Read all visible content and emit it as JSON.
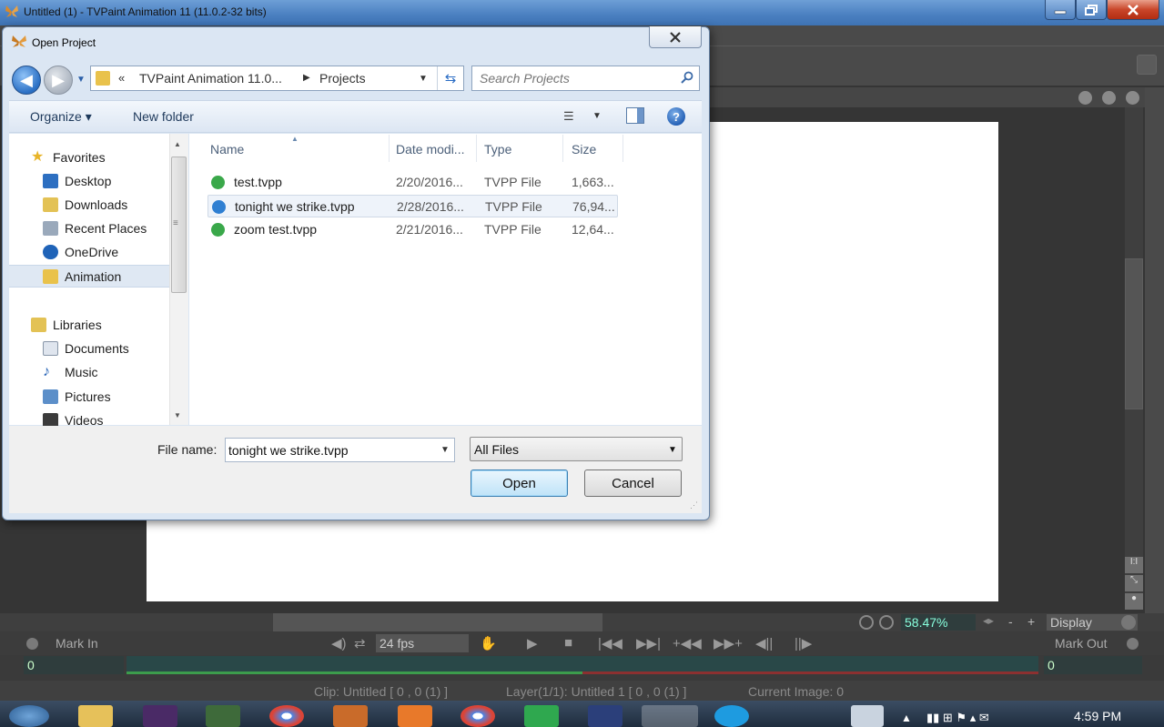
{
  "app": {
    "title": "Untitled (1) - TVPaint Animation 11 (11.0.2-32 bits)",
    "zoom": "58.47%",
    "display_label": "Display",
    "fps": "24 fps",
    "mark_in": "Mark In",
    "mark_out": "Mark Out",
    "start_frame": "0",
    "end_frame": "0",
    "status_clip": "Clip: Untitled [ 0 , 0  (1) ]",
    "status_layer": "Layer(1/1): Untitled 1 [ 0 , 0  (1) ]",
    "status_image": "Current Image: 0",
    "zoom_minus": "-",
    "zoom_plus": "+"
  },
  "taskbar": {
    "clock": "4:59 PM"
  },
  "dialog": {
    "title": "Open Project",
    "address": {
      "chevron": "«",
      "part1": "TVPaint Animation 11.0...",
      "part2": "Projects"
    },
    "search_placeholder": "Search Projects",
    "toolbar": {
      "organize": "Organize ▾",
      "new_folder": "New folder"
    },
    "nav": {
      "favorites": "Favorites",
      "desktop": "Desktop",
      "downloads": "Downloads",
      "recent_places": "Recent Places",
      "onedrive": "OneDrive",
      "animation": "Animation",
      "libraries": "Libraries",
      "documents": "Documents",
      "music": "Music",
      "pictures": "Pictures",
      "videos": "Videos"
    },
    "columns": {
      "name": "Name",
      "date": "Date modi...",
      "type": "Type",
      "size": "Size"
    },
    "files": [
      {
        "name": "test.tvpp",
        "date": "2/20/2016...",
        "type": "TVPP File",
        "size": "1,663..."
      },
      {
        "name": "tonight we strike.tvpp",
        "date": "2/28/2016...",
        "type": "TVPP File",
        "size": "76,94..."
      },
      {
        "name": "zoom test.tvpp",
        "date": "2/21/2016...",
        "type": "TVPP File",
        "size": "12,64..."
      }
    ],
    "file_name_label": "File name:",
    "file_name_value": "tonight we strike.tvpp",
    "file_type": "All Files",
    "open_label": "Open",
    "cancel_label": "Cancel"
  },
  "colors": {
    "titlebar": "#4a7fc0",
    "dialog_bg": "#dbe6f3",
    "canvas": "#ffffff",
    "timeline_green": "#3c9c4c",
    "timeline_red": "#8c3030"
  }
}
